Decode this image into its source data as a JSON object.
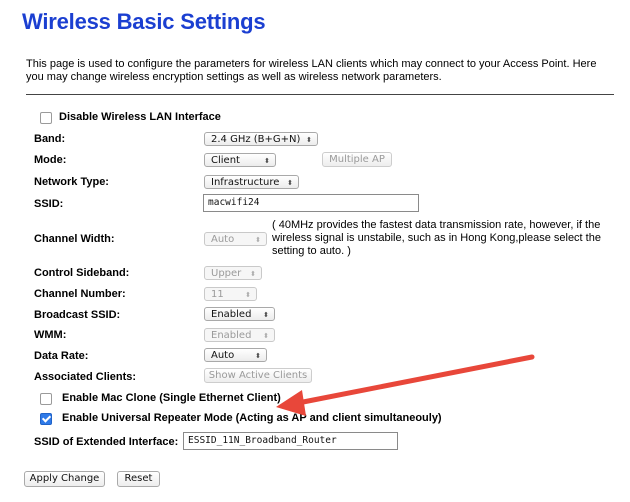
{
  "page": {
    "title": "Wireless Basic Settings",
    "description": "This page is used to configure the parameters for wireless LAN clients which may connect to your Access Point. Here you may change wireless encryption settings as well as wireless network parameters."
  },
  "form": {
    "disable_wlan": {
      "label": "Disable Wireless LAN Interface",
      "checked": false
    },
    "band": {
      "label": "Band:",
      "value": "2.4 GHz (B+G+N)"
    },
    "mode": {
      "label": "Mode:",
      "value": "Client",
      "multiple_ap_label": "Multiple AP"
    },
    "network_type": {
      "label": "Network Type:",
      "value": "Infrastructure"
    },
    "ssid": {
      "label": "SSID:",
      "value": "macwifi24"
    },
    "channel_width": {
      "label": "Channel Width:",
      "value": "Auto",
      "note": "( 40MHz provides the fastest data transmission rate, however, if the wireless signal is unstabile, such as in Hong Kong,please select the setting to auto. )"
    },
    "control_sideband": {
      "label": "Control Sideband:",
      "value": "Upper"
    },
    "channel_number": {
      "label": "Channel Number:",
      "value": "11"
    },
    "broadcast_ssid": {
      "label": "Broadcast SSID:",
      "value": "Enabled"
    },
    "wmm": {
      "label": "WMM:",
      "value": "Enabled"
    },
    "data_rate": {
      "label": "Data Rate:",
      "value": "Auto"
    },
    "associated_clients": {
      "label": "Associated Clients:",
      "button_label": "Show Active Clients"
    },
    "mac_clone": {
      "label": "Enable Mac Clone (Single Ethernet Client)",
      "checked": false
    },
    "universal_repeater": {
      "label": "Enable Universal Repeater Mode (Acting as AP and client simultaneouly)",
      "checked": true
    },
    "extended_ssid": {
      "label": "SSID of Extended Interface:",
      "value": "ESSID_11N_Broadband_Router"
    }
  },
  "actions": {
    "apply_label": "Apply Change",
    "reset_label": "Reset"
  },
  "annotation": {
    "arrow_color": "#e8473a"
  },
  "icons": {
    "select_arrow": "⬍"
  }
}
